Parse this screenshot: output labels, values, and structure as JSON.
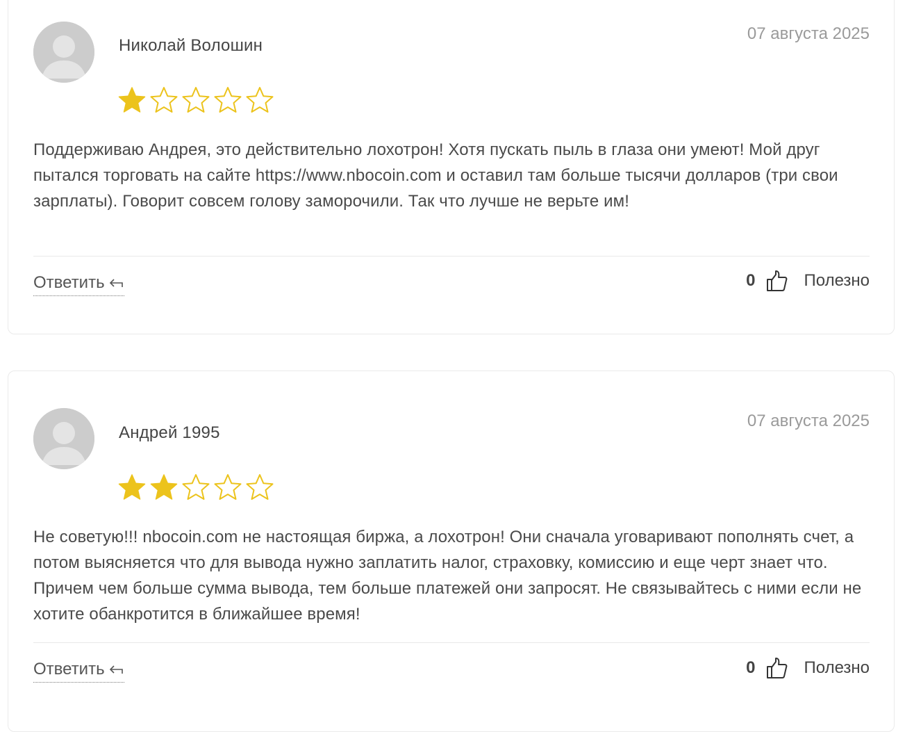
{
  "reviews": [
    {
      "author": "Николай Волошин",
      "date": "07 августа 2025",
      "rating": 1,
      "rating_max": 5,
      "text": "Поддерживаю Андрея, это действительно лохотрон! Хотя пускать пыль в глаза они умеют! Мой друг пытался торговать на сайте https://www.nbocoin.com и оставил там больше тысячи долларов (три свои зарплаты). Говорит совсем голову заморочили. Так что лучше не верьте им!",
      "reply_label": "Ответить",
      "likes": "0",
      "useful_label": "Полезно"
    },
    {
      "author": "Андрей 1995",
      "date": "07 августа 2025",
      "rating": 2,
      "rating_max": 5,
      "text": "Не советую!!! nbocoin.com не настоящая биржа, а лохотрон! Они сначала уговаривают пополнять счет, а потом выясняется что для вывода нужно заплатить налог, страховку, комиссию и еще черт знает что. Причем чем больше сумма вывода, тем больше платежей они запросят. Не связывайтесь с ними если не хотите обанкротится в ближайшее время!",
      "reply_label": "Ответить",
      "likes": "0",
      "useful_label": "Полезно"
    }
  ],
  "colors": {
    "star_filled": "#ECC31C",
    "star_outline": "#ECC31C",
    "avatar_bg": "#CCCCCC",
    "date": "#9A9A9A",
    "text": "#4A4A4A"
  },
  "icons": {
    "avatar": "user-avatar-icon",
    "star": "star-icon",
    "reply": "reply-arrow-icon",
    "like": "thumbs-up-icon"
  }
}
